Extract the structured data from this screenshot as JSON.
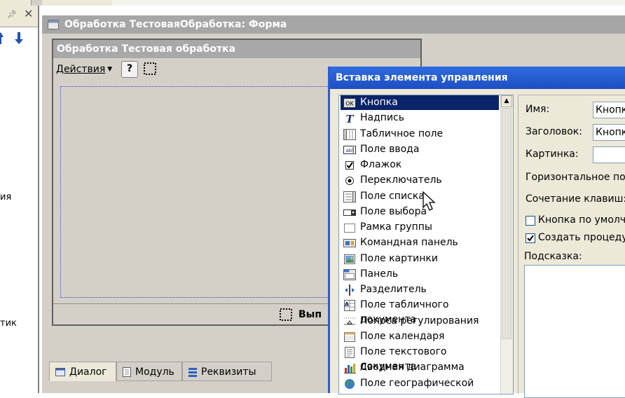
{
  "left_panel": {
    "text_1": "ия",
    "text_2": "тик"
  },
  "form_window": {
    "title": "Обработка ТестоваяОбработка: Форма"
  },
  "inner_form": {
    "title": "Обработка  Тестовая обработка",
    "actions_label": "Действия",
    "help_label": "?",
    "run_label": "Вып"
  },
  "tabs": [
    {
      "label": "Диалог",
      "icon": "dialog-icon"
    },
    {
      "label": "Модуль",
      "icon": "module-icon"
    },
    {
      "label": "Реквизиты",
      "icon": "attributes-icon"
    }
  ],
  "dialog": {
    "title": "Вставка элемента управления",
    "items": [
      {
        "label": "Кнопка",
        "icon": "button-icon",
        "selected": true
      },
      {
        "label": "Надпись",
        "icon": "label-icon"
      },
      {
        "label": "Табличное поле",
        "icon": "table-field-icon"
      },
      {
        "label": "Поле ввода",
        "icon": "input-field-icon"
      },
      {
        "label": "Флажок",
        "icon": "checkbox-icon"
      },
      {
        "label": "Переключатель",
        "icon": "radio-icon"
      },
      {
        "label": "Поле списка",
        "icon": "list-field-icon"
      },
      {
        "label": "Поле выбора",
        "icon": "select-field-icon"
      },
      {
        "label": "Рамка группы",
        "icon": "group-frame-icon"
      },
      {
        "label": "Командная панель",
        "icon": "command-bar-icon"
      },
      {
        "label": "Поле картинки",
        "icon": "picture-field-icon"
      },
      {
        "label": "Панель",
        "icon": "panel-icon"
      },
      {
        "label": "Разделитель",
        "icon": "splitter-icon"
      },
      {
        "label": "Поле табличного документа",
        "icon": "spreadsheet-field-icon"
      },
      {
        "label": "Полоса регулирования",
        "icon": "slider-icon"
      },
      {
        "label": "Поле календаря",
        "icon": "calendar-icon"
      },
      {
        "label": "Поле текстового документа",
        "icon": "text-doc-field-icon"
      },
      {
        "label": "Сводная диаграмма",
        "icon": "pivot-chart-icon"
      },
      {
        "label": "Поле географической схемы",
        "icon": "geo-map-icon"
      }
    ],
    "props": {
      "name_label": "Имя:",
      "name_value": "Кнопка",
      "caption_label": "Заголовок:",
      "caption_value": "Кнопка",
      "picture_label": "Картинка:",
      "picture_value": "",
      "horizontal_label": "Горизонтальное поло",
      "shortcut_label": "Сочетание клавиш:",
      "default_button_label": "Кнопка по умолчан",
      "default_button_checked": false,
      "create_proc_label": "Создать процедуру",
      "create_proc_checked": true,
      "tooltip_label": "Подсказка:"
    }
  }
}
